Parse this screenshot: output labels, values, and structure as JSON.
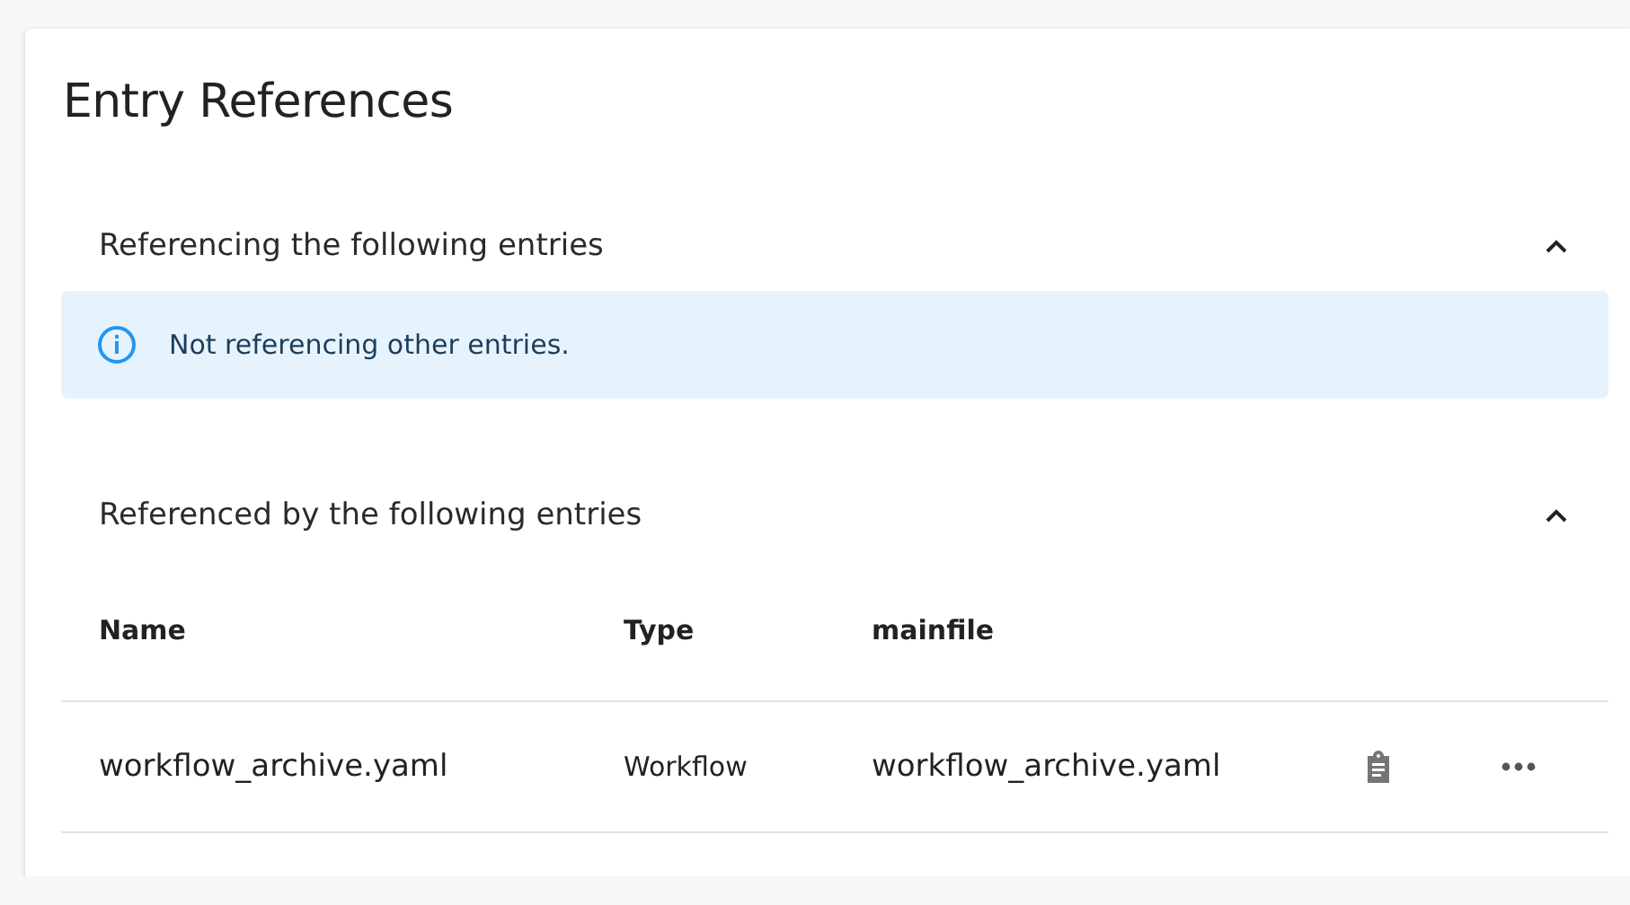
{
  "title": "Entry References",
  "sections": [
    {
      "kind": "notice",
      "heading": "Referencing the following entries",
      "expanded": true,
      "message": "Not referencing other entries."
    },
    {
      "kind": "table",
      "heading": "Referenced by the following entries",
      "expanded": true,
      "columns": [
        "Name",
        "Type",
        "mainfile"
      ],
      "rows": [
        {
          "cells": [
            "workflow_archive.yaml",
            "Workflow",
            "workflow_archive.yaml"
          ]
        }
      ]
    }
  ]
}
